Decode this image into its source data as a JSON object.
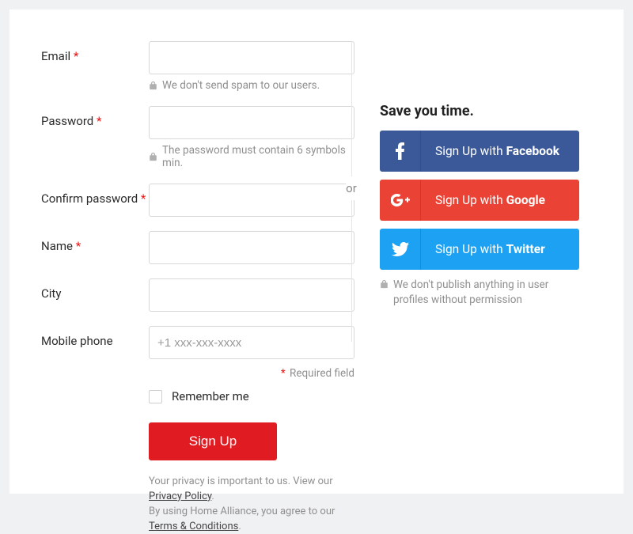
{
  "form": {
    "email": {
      "label": "Email",
      "required": true,
      "value": "",
      "hint": "We don't send spam to our users."
    },
    "password": {
      "label": "Password",
      "required": true,
      "value": "",
      "hint": "The password must contain 6 symbols min."
    },
    "confirm": {
      "label": "Confirm password",
      "required": true,
      "value": ""
    },
    "name": {
      "label": "Name",
      "required": true,
      "value": ""
    },
    "city": {
      "label": "City",
      "required": false,
      "value": ""
    },
    "phone": {
      "label": "Mobile phone",
      "required": false,
      "value": "",
      "placeholder": "+1 xxx-xxx-xxxx"
    },
    "required_note": "Required field",
    "remember": {
      "label": "Remember me",
      "checked": false
    },
    "submit": "Sign Up",
    "legal": {
      "line1_pre": "Your privacy is important to us. View our ",
      "privacy": "Privacy Policy",
      "line2_pre": "By using Home Alliance, you agree to our ",
      "terms": "Terms & Conditions"
    }
  },
  "divider": {
    "or": "or"
  },
  "social": {
    "title": "Save you time.",
    "facebook": {
      "prefix": "Sign Up with ",
      "brand": "Facebook"
    },
    "google": {
      "prefix": "Sign Up with ",
      "brand": "Google"
    },
    "twitter": {
      "prefix": "Sign Up with ",
      "brand": "Twitter"
    },
    "hint": "We don't publish anything in user profiles without permission"
  },
  "required_marker": "*"
}
